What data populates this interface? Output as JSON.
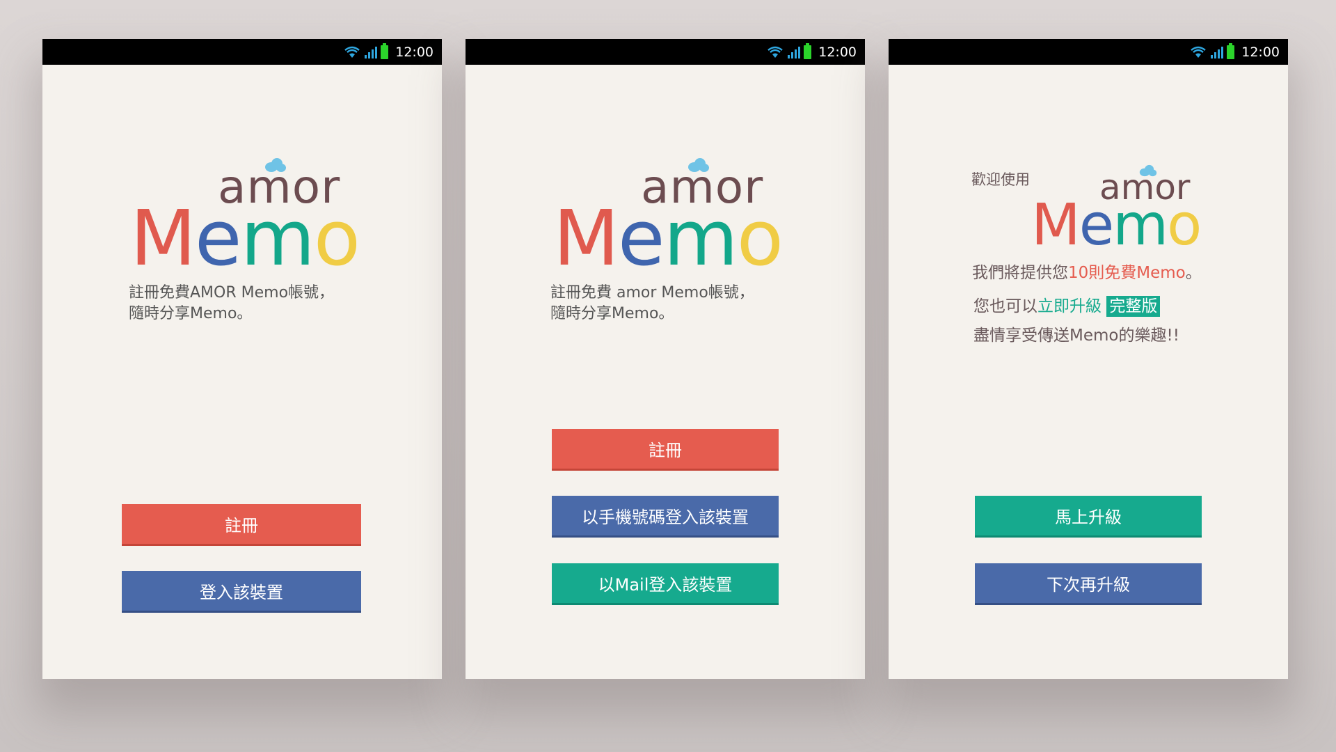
{
  "status": {
    "time": "12:00"
  },
  "logo": {
    "amor": "amor",
    "memo_M": "M",
    "memo_e": "e",
    "memo_m": "m",
    "memo_o": "o"
  },
  "screen1": {
    "desc_line1": "註冊免費AMOR Memo帳號，",
    "desc_line2": "隨時分享Memo。",
    "register_label": "註冊",
    "login_label": "登入該裝置"
  },
  "screen2": {
    "desc_line1": "註冊免費 amor Memo帳號，",
    "desc_line2": "隨時分享Memo。",
    "register_label": "註冊",
    "phone_login_label": "以手機號碼登入該裝置",
    "mail_login_label": "以Mail登入該裝置"
  },
  "screen3": {
    "welcome": "歡迎使用",
    "line1_pre": "我們將提供您",
    "line1_hl": "10則免費Memo",
    "line1_post": "。",
    "line2_pre": "您也可以",
    "line2_hl": "立即升級",
    "line2_badge": "完整版",
    "line3": "盡情享受傳送Memo的樂趣!!",
    "upgrade_now_label": "馬上升級",
    "upgrade_later_label": "下次再升級"
  },
  "colors": {
    "red": "#e55c4f",
    "blue": "#4a6aa9",
    "green": "#16aa8e",
    "yellow": "#f0cc45",
    "brown": "#6c4c50"
  },
  "icons": [
    "wifi-icon",
    "signal-icon",
    "battery-icon"
  ]
}
